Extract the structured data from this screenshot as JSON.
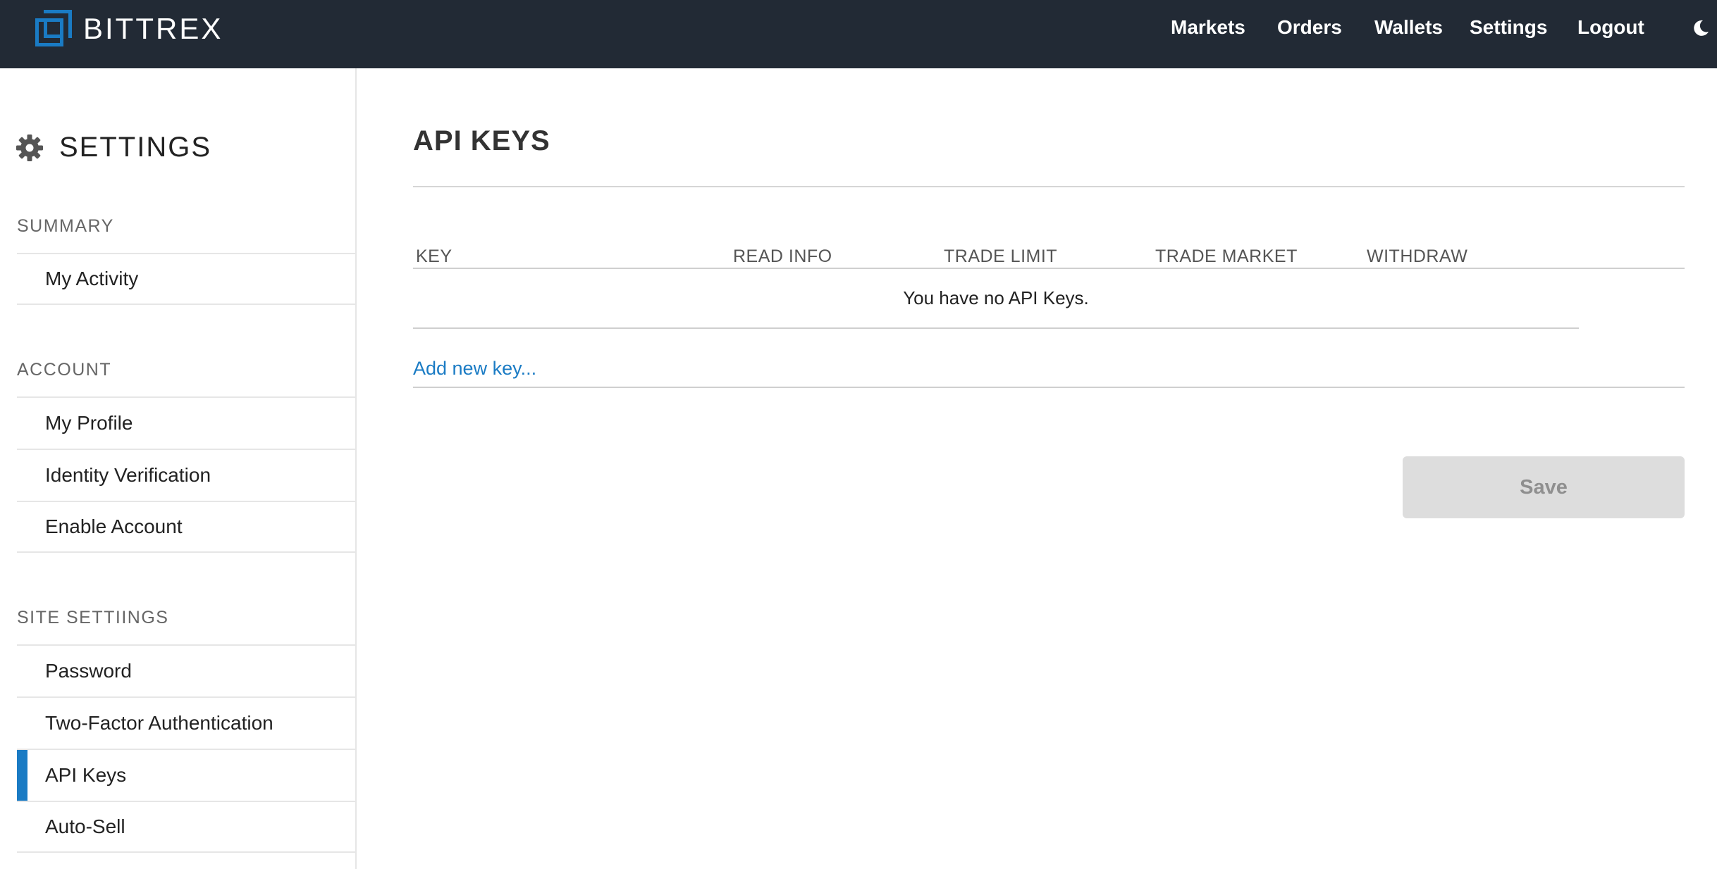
{
  "brand": {
    "name": "BITTREX"
  },
  "nav": {
    "items": [
      "Markets",
      "Orders",
      "Wallets",
      "Settings",
      "Logout"
    ],
    "theme_icon": "moon-icon"
  },
  "sidebar": {
    "title": "SETTINGS",
    "title_icon": "gear-icon",
    "sections": [
      {
        "label": "SUMMARY",
        "items": [
          "My Activity"
        ]
      },
      {
        "label": "ACCOUNT",
        "items": [
          "My Profile",
          "Identity Verification",
          "Enable Account"
        ]
      },
      {
        "label": "SITE SETTIINGS",
        "items": [
          "Password",
          "Two-Factor Authentication",
          "API Keys",
          "Auto-Sell"
        ]
      }
    ],
    "active_item": "API Keys"
  },
  "main": {
    "title": "API KEYS",
    "table": {
      "headers": [
        "KEY",
        "READ INFO",
        "TRADE LIMIT",
        "TRADE MARKET",
        "WITHDRAW"
      ],
      "empty_message": "You have no API Keys."
    },
    "add_link": "Add new key...",
    "save_label": "Save"
  },
  "colors": {
    "topbar": "#222a35",
    "accent": "#1a7bc4",
    "disabled_button": "#dddddd"
  }
}
